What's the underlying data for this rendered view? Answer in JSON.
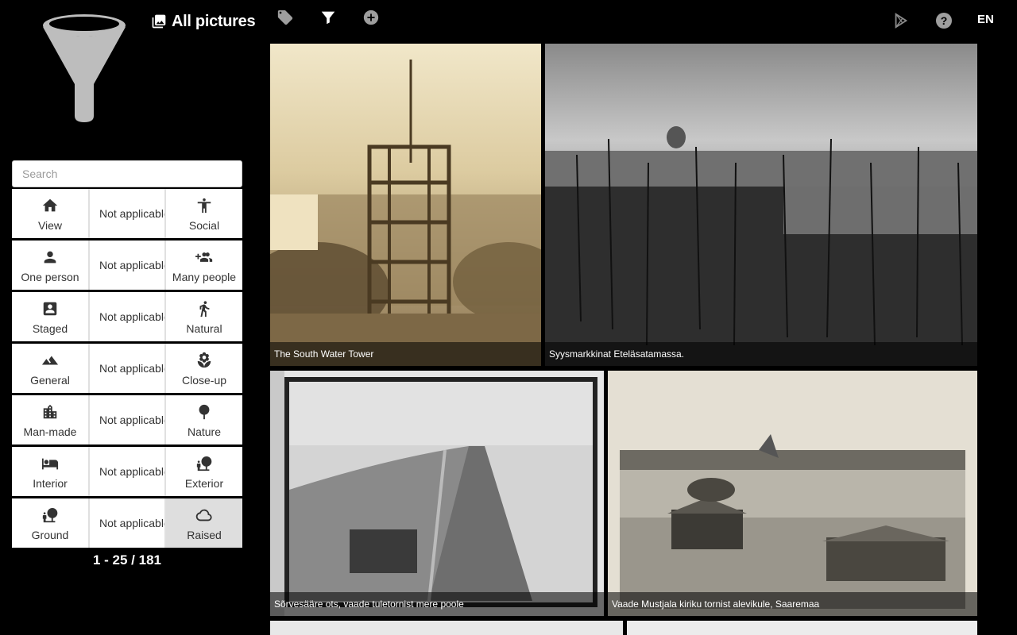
{
  "header": {
    "title": "All pictures",
    "lang": "EN",
    "icons": [
      "tag-icon",
      "filter-icon",
      "add-circle-icon",
      "play-store-icon",
      "help-icon"
    ]
  },
  "sidebar": {
    "search_placeholder": "Search",
    "filters": [
      {
        "left": "View",
        "mid": "Not applicable",
        "right": "Social"
      },
      {
        "left": "One person",
        "mid": "Not applicable",
        "right": "Many people"
      },
      {
        "left": "Staged",
        "mid": "Not applicable",
        "right": "Natural"
      },
      {
        "left": "General",
        "mid": "Not applicable",
        "right": "Close-up"
      },
      {
        "left": "Man-made",
        "mid": "Not applicable",
        "right": "Nature"
      },
      {
        "left": "Interior",
        "mid": "Not applicable",
        "right": "Exterior"
      },
      {
        "left": "Ground",
        "mid": "Not applicable",
        "right": "Raised"
      }
    ],
    "count": "1 - 25 / 181"
  },
  "gallery": [
    {
      "caption": "The South Water Tower"
    },
    {
      "caption": "Syysmarkkinat Eteläsatamassa."
    },
    {
      "caption": "Sõrvesääre ots, vaade tuletornist mere poole"
    },
    {
      "caption": "Vaade Mustjala kiriku tornist alevikule, Saaremaa"
    }
  ]
}
